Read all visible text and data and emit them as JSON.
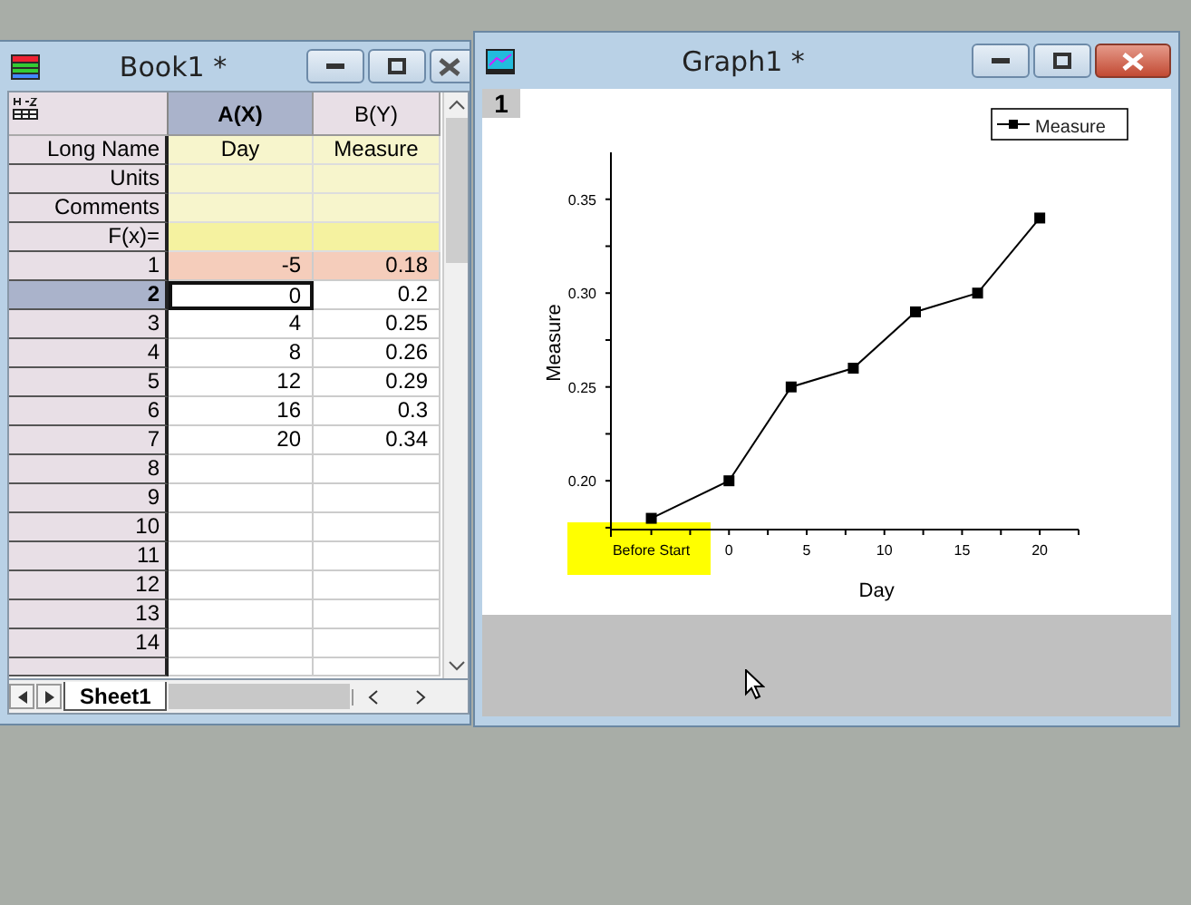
{
  "book_window": {
    "title": "Book1 *",
    "columns": [
      {
        "label": "A(X)",
        "selected": true
      },
      {
        "label": "B(Y)",
        "selected": false
      }
    ],
    "label_rows": [
      {
        "label": "Long Name",
        "kind": "label",
        "values": [
          "Day",
          "Measure"
        ]
      },
      {
        "label": "Units",
        "kind": "label"
      },
      {
        "label": "Comments",
        "kind": "label"
      },
      {
        "label": "F(x)=",
        "kind": "formula"
      }
    ],
    "rows": [
      {
        "label": "1",
        "values": [
          "-5",
          "0.18"
        ],
        "selected": false,
        "highlighted": true
      },
      {
        "label": "2",
        "values": [
          "0",
          "0.2"
        ],
        "selected": true,
        "highlighted": false
      },
      {
        "label": "3",
        "values": [
          "4",
          "0.25"
        ],
        "selected": false,
        "highlighted": false
      },
      {
        "label": "4",
        "values": [
          "8",
          "0.26"
        ],
        "selected": false,
        "highlighted": false
      },
      {
        "label": "5",
        "values": [
          "12",
          "0.29"
        ],
        "selected": false,
        "highlighted": false
      },
      {
        "label": "6",
        "values": [
          "16",
          "0.3"
        ],
        "selected": false,
        "highlighted": false
      },
      {
        "label": "7",
        "values": [
          "20",
          "0.34"
        ],
        "selected": false,
        "highlighted": false
      },
      {
        "label": "8",
        "selected": false,
        "highlighted": false
      },
      {
        "label": "9",
        "selected": false,
        "highlighted": false
      },
      {
        "label": "10",
        "selected": false,
        "highlighted": false
      },
      {
        "label": "11",
        "selected": false,
        "highlighted": false
      },
      {
        "label": "12",
        "selected": false,
        "highlighted": false
      },
      {
        "label": "13",
        "selected": false,
        "highlighted": false
      },
      {
        "label": "14",
        "selected": false,
        "highlighted": false
      }
    ],
    "sheet_tabs": [
      {
        "label": "Sheet1",
        "selected": true
      }
    ]
  },
  "graph_window": {
    "title": "Graph1 *",
    "layer": "1",
    "chart_data": {
      "type": "line",
      "xlabel": "Day",
      "ylabel": "Measure",
      "x": [
        -5,
        0,
        4,
        8,
        12,
        16,
        20
      ],
      "series": [
        {
          "name": "Measure",
          "color": "#000000",
          "marker": "square",
          "values": [
            0.18,
            0.2,
            0.25,
            0.26,
            0.29,
            0.3,
            0.34
          ]
        }
      ],
      "xlim": [
        -7.6,
        22.5
      ],
      "ylim": [
        0.174,
        0.375
      ],
      "xticks": [
        {
          "value": -5,
          "label": "Before Start"
        },
        0,
        5,
        10,
        15,
        20
      ],
      "yticks": [
        {
          "value": 0.2,
          "label": "0.20"
        },
        {
          "value": 0.25,
          "label": "0.25"
        },
        {
          "value": 0.3,
          "label": "0.30"
        },
        {
          "value": 0.35,
          "label": "0.35"
        }
      ]
    }
  }
}
